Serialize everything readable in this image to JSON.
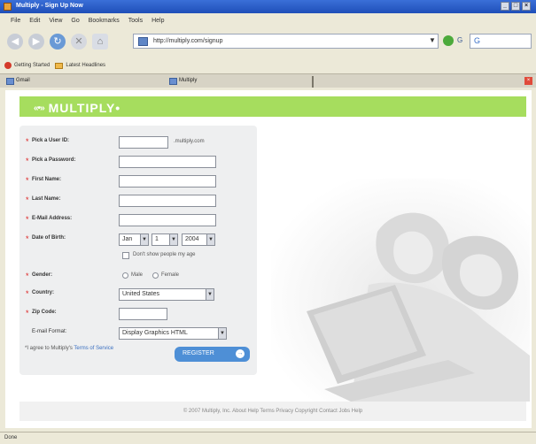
{
  "window": {
    "title": "Multiply - Sign Up Now",
    "buttons": [
      "_",
      "□",
      "×"
    ]
  },
  "menu": [
    "File",
    "Edit",
    "View",
    "Go",
    "Bookmarks",
    "Tools",
    "Help"
  ],
  "toolbar": {
    "address": "http://multiply.com/signup",
    "dropdown_glyph": "▼",
    "search_engine_glyph": "G",
    "search_glyph": "G"
  },
  "bookmarks": [
    "Getting Started",
    "Latest Headlines"
  ],
  "tabs": {
    "first": "Gmail",
    "second": "Multiply",
    "close_glyph": "×"
  },
  "brand": {
    "mark": "«•»",
    "name": "MULTIPLY•",
    "bar_color": "#a6dd5e"
  },
  "form": {
    "fields": [
      {
        "label": "Pick a User ID:",
        "hint": ".multiply.com"
      },
      {
        "label": "Pick a Password:"
      },
      {
        "label": "First Name:"
      },
      {
        "label": "Last Name:"
      },
      {
        "label": "E-Mail Address:"
      }
    ],
    "dob": {
      "label": "Date of Birth:",
      "month": "Jan",
      "day": "1",
      "year": "2004",
      "hide_label": "Don't show people my age"
    },
    "gender": {
      "label": "Gender:",
      "options": [
        "Male",
        "Female"
      ]
    },
    "country": {
      "label": "Country:",
      "value": "United States"
    },
    "zip": {
      "label": "Zip Code:"
    },
    "email_format": {
      "label": "E-mail Format:",
      "value": "Display Graphics HTML"
    },
    "terms_text": "*I agree to Multiply's ",
    "terms_link": "Terms of Service",
    "register_label": "REGISTER",
    "register_arrow": "→"
  },
  "footer": "© 2007 Multiply, Inc.  About  Help  Terms  Privacy  Copyright  Contact  Jobs  Help",
  "status": "Done"
}
